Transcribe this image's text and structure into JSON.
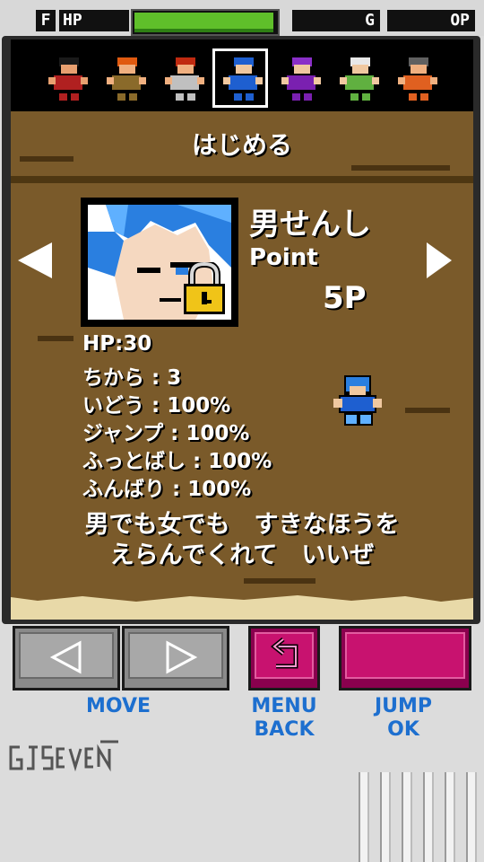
{
  "hud": {
    "f_label": "F",
    "hp_label": "HP",
    "g_label": "G",
    "op_label": "OP",
    "hp_fill": 0.98
  },
  "portraits": [
    {
      "name": "character-1",
      "hair": "#1a1a1a",
      "skin": "#e8a070",
      "cloth": "#b02020"
    },
    {
      "name": "character-2",
      "hair": "#e05a10",
      "skin": "#f0b080",
      "cloth": "#8a6a2a"
    },
    {
      "name": "character-3",
      "hair": "#c02a10",
      "skin": "#f0b080",
      "cloth": "#c0c0c0"
    },
    {
      "name": "character-4",
      "hair": "#1e5fd0",
      "skin": "#f0c8a0",
      "cloth": "#1e5fd0"
    },
    {
      "name": "character-5",
      "hair": "#8a2fc8",
      "skin": "#f0c8a0",
      "cloth": "#7a20b0"
    },
    {
      "name": "character-6",
      "hair": "#e8e8e8",
      "skin": "#f0c8a0",
      "cloth": "#60b040"
    },
    {
      "name": "character-7",
      "hair": "#606060",
      "skin": "#f0b080",
      "cloth": "#e06020"
    }
  ],
  "selected_index": 3,
  "start_label": "はじめる",
  "character": {
    "name": "男せんし",
    "point_label": "Point",
    "point_value": "5P",
    "locked": true
  },
  "stats": [
    "HP:30",
    "ちから : 3",
    "いどう : 100%",
    "ジャンプ : 100%",
    "ふっとばし : 100%",
    "ふんばり : 100%"
  ],
  "message": [
    "男でも女でも　すきなほうを",
    "えらんでくれて　いいぜ"
  ],
  "buttons": {
    "move_label": "MOVE",
    "menu_label_1": "MENU",
    "menu_label_2": "BACK",
    "jump_label_1": "JUMP",
    "jump_label_2": "OK"
  },
  "colors": {
    "panel": "#7a5a2a",
    "hp_green": "#5fbf2a",
    "button_magenta": "#c8126f",
    "label_blue": "#1d6fcf"
  }
}
